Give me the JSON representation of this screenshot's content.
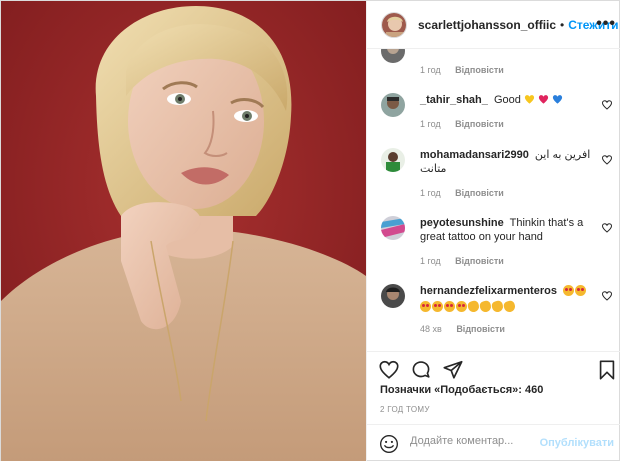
{
  "header": {
    "username": "scarlettjohansson_offiic",
    "separator": "•",
    "follow_label": "Стежити",
    "more_label": "•••"
  },
  "comments": [
    {
      "username": "",
      "text": "",
      "time": "1 год",
      "reply_label": "Відповісти"
    },
    {
      "username": "_tahir_shah_",
      "text": "Good",
      "emojis": [
        "yellow-heart",
        "red-heart",
        "blue-heart"
      ],
      "time": "1 год",
      "reply_label": "Відповісти"
    },
    {
      "username": "mohamadansari2990",
      "text": "افرین به این متانت",
      "time": "1 год",
      "reply_label": "Відповісти"
    },
    {
      "username": "peyotesunshine",
      "text": "Thinkin that's a great tattoo on your hand",
      "time": "1 год",
      "reply_label": "Відповісти"
    },
    {
      "username": "hernandezfelixarmenteros",
      "text": "",
      "emojis": [
        "heart-eyes",
        "heart-eyes",
        "heart-eyes",
        "heart-eyes",
        "heart-eyes",
        "heart-eyes",
        "clapping-hands",
        "clapping-hands",
        "clapping-hands",
        "clapping-hands"
      ],
      "time": "48 хв",
      "reply_label": "Відповісти"
    }
  ],
  "actions": {
    "like_icon": "heart-icon",
    "comment_icon": "comment-icon",
    "share_icon": "share-icon",
    "save_icon": "bookmark-icon"
  },
  "likes_text": "Позначки «Подобається»: 460",
  "time_ago": "2 ГОД ТОМУ",
  "add_comment": {
    "placeholder": "Додайте коментар...",
    "post_label": "Опублікувати"
  },
  "colors": {
    "accent": "#0095f6",
    "post_disabled": "#b2dffc",
    "muted": "#8e8e8e",
    "photo_background": "#8f1f22"
  }
}
